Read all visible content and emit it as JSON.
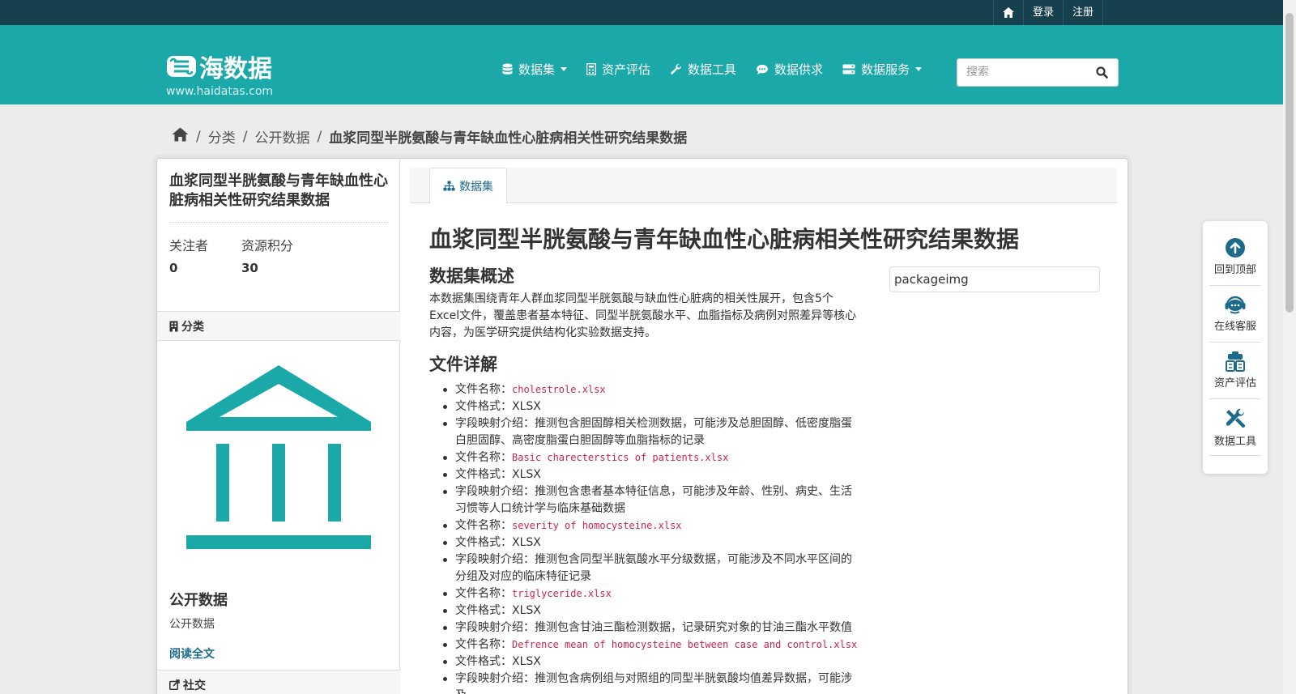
{
  "account": {
    "login": "登录",
    "register": "注册"
  },
  "brand": {
    "name": "海数据",
    "url": "www.haidatas.com",
    "color": "#1aa8a8"
  },
  "nav": [
    {
      "label": "数据集",
      "icon": "database-icon",
      "dropdown": true
    },
    {
      "label": "资产评估",
      "icon": "calculator-icon",
      "dropdown": false
    },
    {
      "label": "数据工具",
      "icon": "wrench-icon",
      "dropdown": false
    },
    {
      "label": "数据供求",
      "icon": "comment-icon",
      "dropdown": false
    },
    {
      "label": "数据服务",
      "icon": "server-icon",
      "dropdown": true
    }
  ],
  "search": {
    "placeholder": "搜索"
  },
  "breadcrumb": {
    "category": "分类",
    "org": "公开数据",
    "current": "血浆同型半胱氨酸与青年缺血性心脏病相关性研究结果数据"
  },
  "sidebar": {
    "title": "血浆同型半胱氨酸与青年缺血性心脏病相关性研究结果数据",
    "followers_label": "关注者",
    "followers_value": "0",
    "points_label": "资源积分",
    "points_value": "30",
    "category_heading": "分类",
    "org_heading": "公开数据",
    "org_desc": "公开数据",
    "read_more": "阅读全文",
    "social_heading": "社交"
  },
  "content": {
    "tab_label": "数据集",
    "heading": "血浆同型半胱氨酸与青年缺血性心脏病相关性研究结果数据",
    "overview_heading": "数据集概述",
    "overview_text": "本数据集围绕青年人群血浆同型半胱氨酸与缺血性心脏病的相关性展开，包含5个Excel文件，覆盖患者基本特征、同型半胱氨酸水平、血脂指标及病例对照差异等核心内容，为医学研究提供结构化实验数据支持。",
    "image_alt": "packageimg",
    "files_heading": "文件详解",
    "name_prefix": "文件名称：",
    "format_prefix": "文件格式：",
    "desc_prefix": "字段映射介绍：",
    "files": [
      {
        "name": "cholestrole.xlsx",
        "format": "XLSX",
        "desc": "推测包含胆固醇相关检测数据，可能涉及总胆固醇、低密度脂蛋白胆固醇、高密度脂蛋白胆固醇等血脂指标的记录"
      },
      {
        "name": "Basic charecterstics of patients.xlsx",
        "format": "XLSX",
        "desc": "推测包含患者基本特征信息，可能涉及年龄、性别、病史、生活习惯等人口统计学与临床基础数据"
      },
      {
        "name": "severity of homocysteine.xlsx",
        "format": "XLSX",
        "desc": "推测包含同型半胱氨酸水平分级数据，可能涉及不同水平区间的分组及对应的临床特征记录"
      },
      {
        "name": "triglyceride.xlsx",
        "format": "XLSX",
        "desc": "推测包含甘油三酯检测数据，记录研究对象的甘油三酯水平数值"
      },
      {
        "name": "Defrence mean of homocysteine between case and control.xlsx",
        "format": "XLSX",
        "desc": "推测包含病例组与对照组的同型半胱氨酸均值差异数据，可能涉及"
      }
    ]
  },
  "float_tools": [
    {
      "label": "回到顶部",
      "icon": "arrow-up-circle-icon"
    },
    {
      "label": "在线客服",
      "icon": "headset-icon"
    },
    {
      "label": "资产评估",
      "icon": "clipboard-icon"
    },
    {
      "label": "数据工具",
      "icon": "tools-icon"
    }
  ]
}
